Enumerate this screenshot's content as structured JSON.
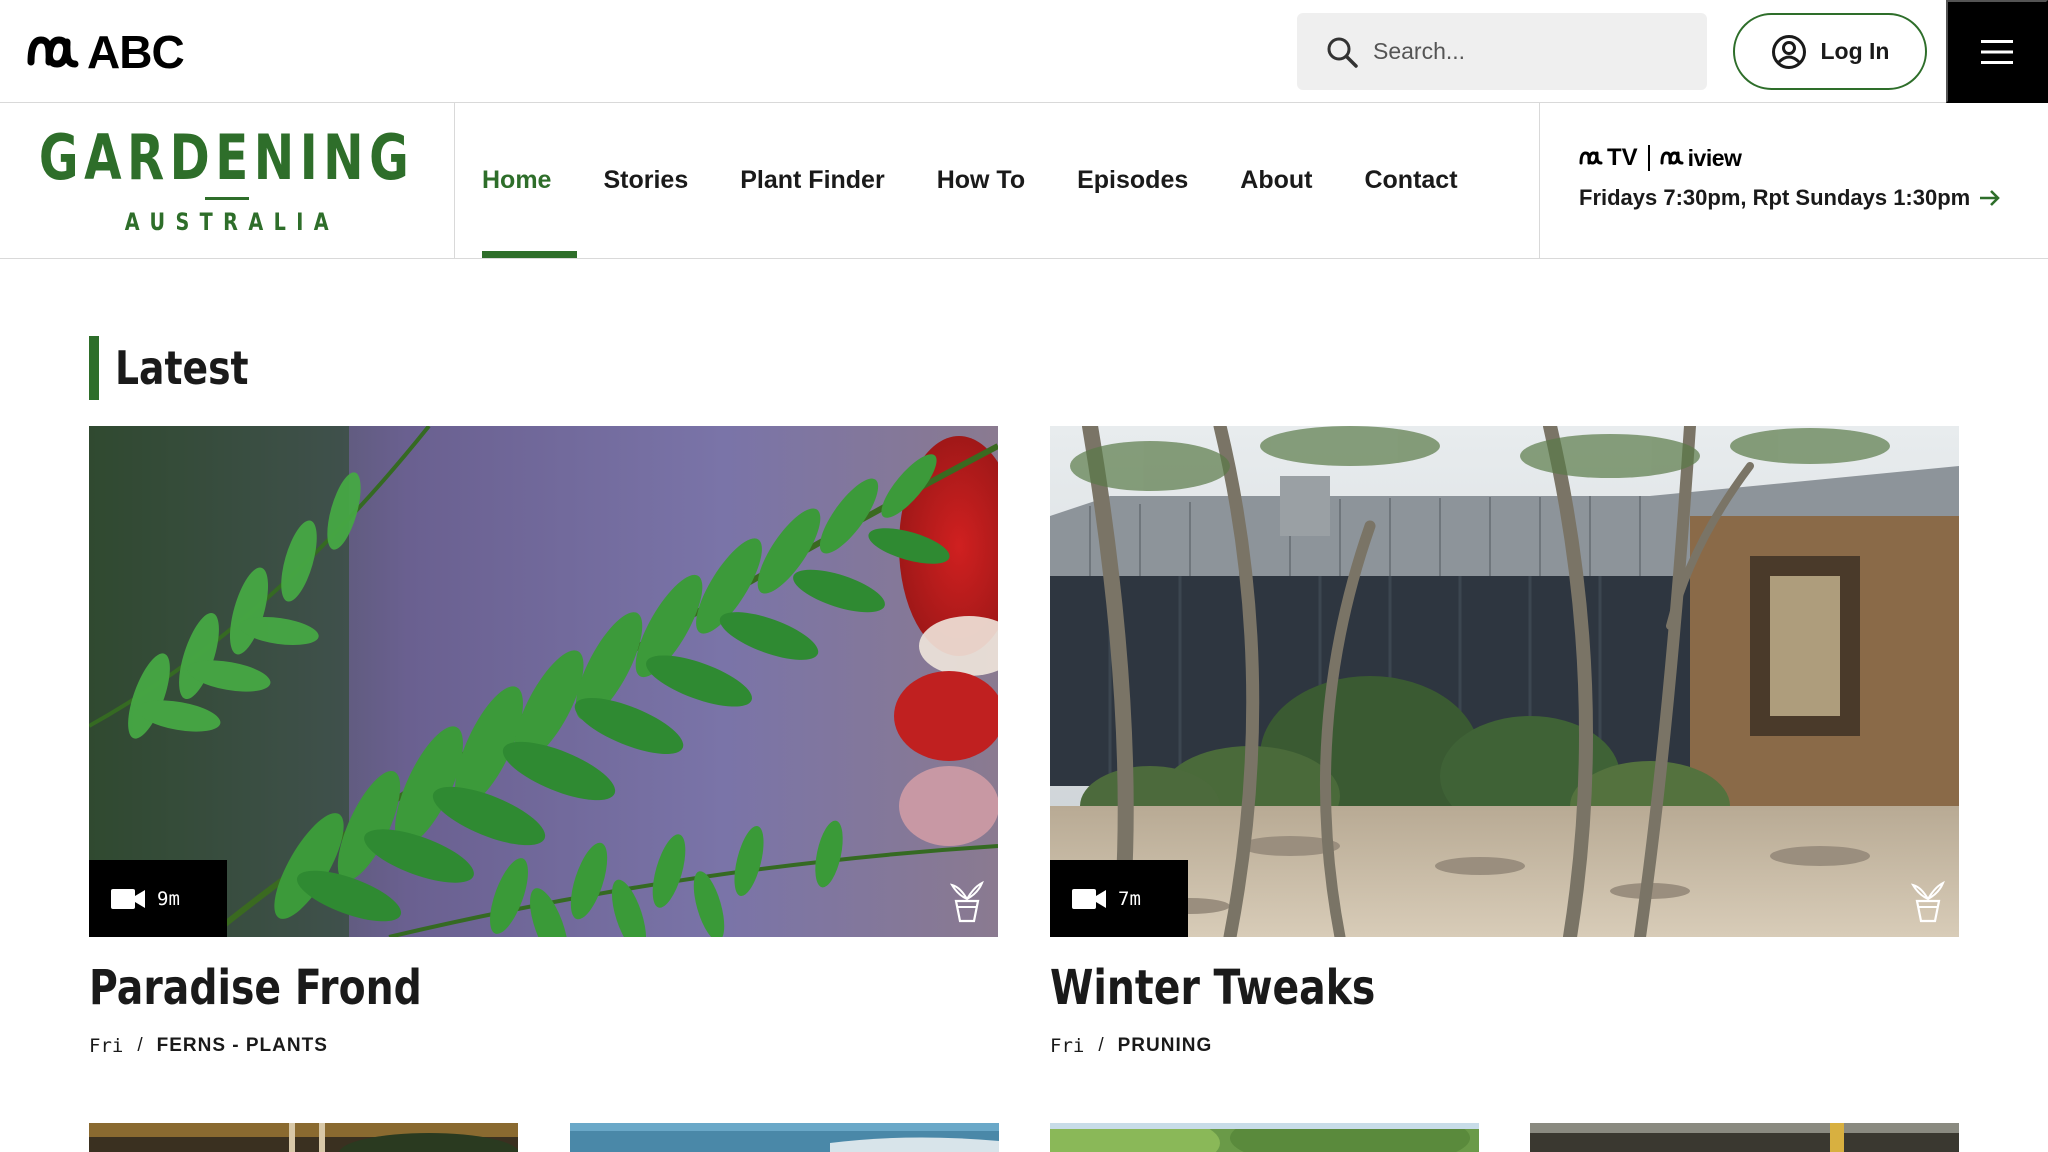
{
  "header": {
    "logo_text": "ABC",
    "search_placeholder": "Search...",
    "login_label": "Log In"
  },
  "brand": {
    "line1": "GARDENING",
    "line2": "AUSTRALIA"
  },
  "nav": {
    "items": [
      {
        "label": "Home",
        "active": true
      },
      {
        "label": "Stories"
      },
      {
        "label": "Plant Finder"
      },
      {
        "label": "How To"
      },
      {
        "label": "Episodes"
      },
      {
        "label": "About"
      },
      {
        "label": "Contact"
      }
    ]
  },
  "broadcast": {
    "tv_label": "TV",
    "iview_label": "iview",
    "schedule": "Fridays 7:30pm, Rpt Sundays 1:30pm"
  },
  "latest": {
    "title": "Latest",
    "cards": [
      {
        "title": "Paradise Frond",
        "duration": "9m",
        "day": "Fri",
        "tag": "FERNS - PLANTS"
      },
      {
        "title": "Winter Tweaks",
        "duration": "7m",
        "day": "Fri",
        "tag": "PRUNING"
      }
    ]
  },
  "colors": {
    "brand_green": "#2e6e2a",
    "nav_border": "#d9d9d9",
    "search_bg": "#efefef"
  },
  "icons": [
    "abc-logo-icon",
    "search-icon",
    "user-circle-icon",
    "hamburger-icon",
    "arrow-right-icon",
    "video-camera-icon",
    "plant-pot-icon"
  ]
}
